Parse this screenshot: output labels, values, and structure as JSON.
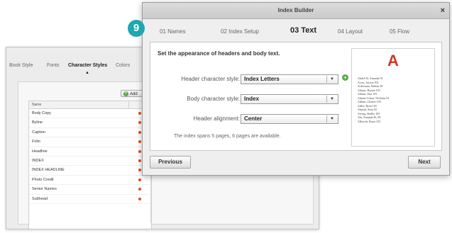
{
  "background_window": {
    "tabs": [
      "Book Style",
      "Fonts",
      "Character Styles",
      "Colors"
    ],
    "active_tab": "Character Styles",
    "add_button_label": "Add",
    "table_header": "Name",
    "rows": [
      "Body Copy",
      "Byline",
      "Caption",
      "Folio",
      "Headline",
      "INDEX",
      "INDEX HEADLINE",
      "Photo Credit",
      "Senior Names",
      "Subhead"
    ]
  },
  "dialog": {
    "title": "Index Builder",
    "close_label": "×",
    "steps": [
      "01 Names",
      "02 Index Setup",
      "03 Text",
      "04 Layout",
      "05 Flow"
    ],
    "active_step": "03 Text",
    "heading": "Set the appearance of headers and body text.",
    "header_style": {
      "label": "Header character style:",
      "value": "Index Letters"
    },
    "body_style": {
      "label": "Body character style:",
      "value": "Index"
    },
    "header_alignment": {
      "label": "Header alignment:",
      "value": "Center"
    },
    "info_text": "The index spans 5 pages, 6 pages are available.",
    "preview": {
      "letter": "A",
      "entries": [
        "Abdel-Al, Amanda   92",
        "Acres, Jessica   103",
        "Ackerman, Nathan   30",
        "Adams, Hyrum   103",
        "Adams, Tara   103",
        "Adams-Cohen, Nicholas   92",
        "Adkins, Charles   103",
        "Adley, Ryan   103",
        "Ahmad, Amir   92",
        "Aiving, Shelby   103",
        "Akr, Amanda   46, 90",
        "Albrecht, Brian   103"
      ]
    },
    "previous_label": "Previous",
    "next_label": "Next"
  },
  "callout": {
    "number": "9"
  },
  "colors": {
    "accent_red": "#d0362b",
    "badge_teal": "#1ea7b0",
    "add_green": "#5aa84a"
  },
  "icons": {
    "dropdown": "chevron-down-icon",
    "add": "plus-circle-icon",
    "delete": "dot-icon",
    "close": "close-icon"
  }
}
